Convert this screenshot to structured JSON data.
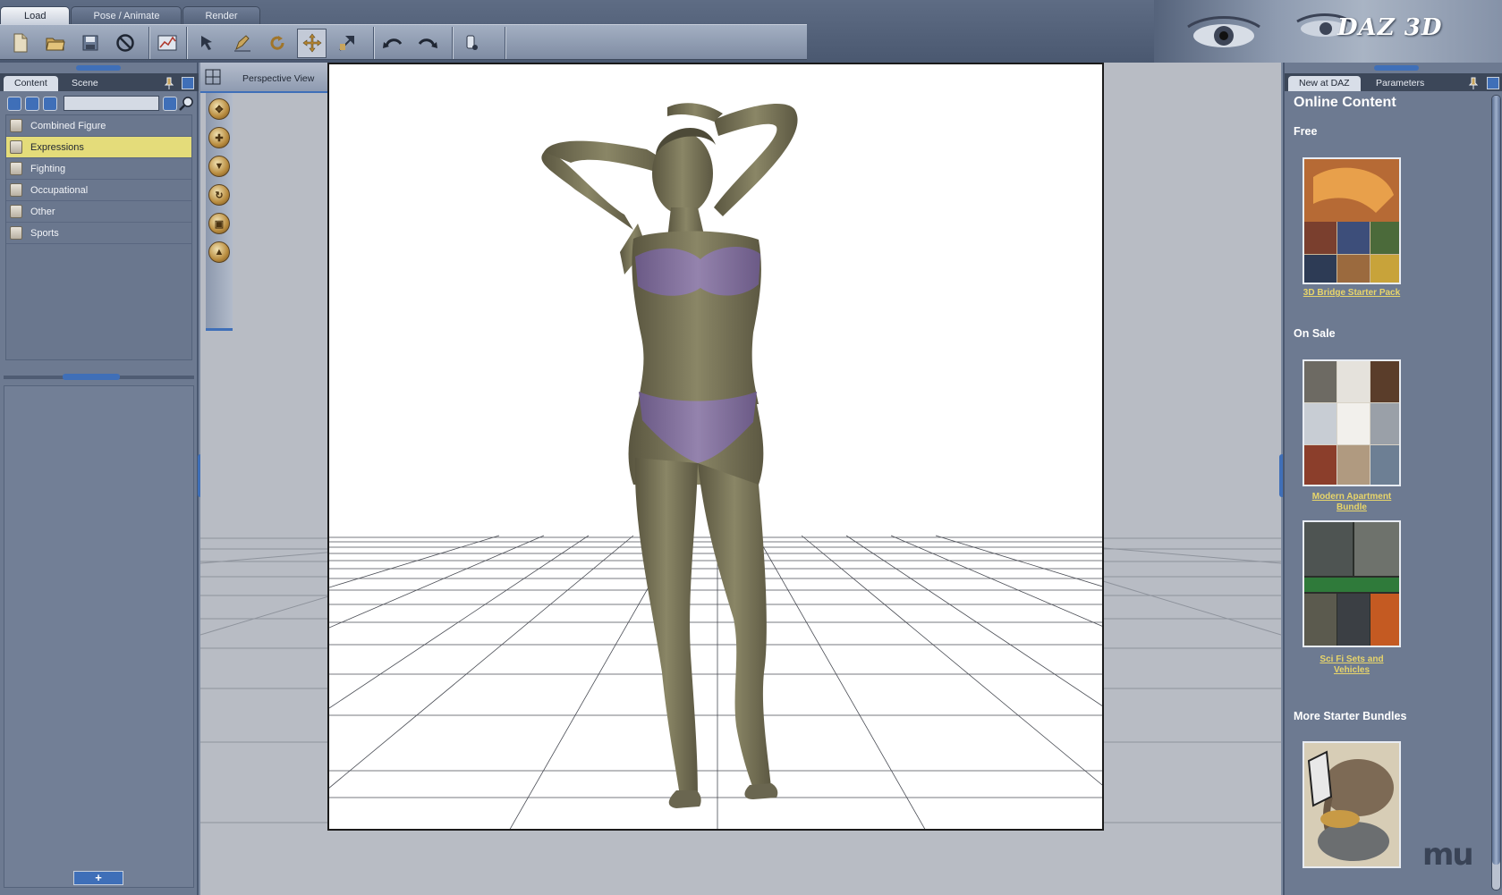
{
  "top_tabs": [
    "Load",
    "Pose / Animate",
    "Render"
  ],
  "toolbar": {
    "icons": [
      "new-file-icon",
      "open-folder-icon",
      "save-disk-icon",
      "stop-icon",
      "chart-icon",
      "select-arrow-icon",
      "pen-icon",
      "rotate-icon",
      "move-cross-icon",
      "scale-icon",
      "undo-arc-icon",
      "redo-arc-icon",
      "bone-tool-icon"
    ]
  },
  "brand": {
    "logo": "DAZ 3D"
  },
  "left_panel": {
    "tabs": [
      "Content",
      "Scene"
    ],
    "path_value": "",
    "categories": [
      "Combined Figure",
      "Expressions",
      "Fighting",
      "Occupational",
      "Other",
      "Sports"
    ],
    "selected_category": "Expressions",
    "add_label": "+"
  },
  "viewport": {
    "title": "Perspective View",
    "dropdown_arrow": "»",
    "shading_arrow": "»",
    "background_color": "#ffffff",
    "camera_tools": [
      "orbit-icon",
      "pan-icon",
      "dolly-icon",
      "rotate-camera-icon",
      "frame-icon",
      "up-icon"
    ]
  },
  "right_panel": {
    "tabs": [
      "New at DAZ",
      "Parameters"
    ],
    "heading": "Online Content",
    "sections": [
      {
        "title": "Free",
        "products": [
          {
            "name": "3D Bridge Starter Pack"
          }
        ]
      },
      {
        "title": "On Sale",
        "products": [
          {
            "name": "Modern Apartment Bundle"
          },
          {
            "name": "Sci Fi Sets and Vehicles"
          }
        ]
      },
      {
        "title": "More Starter Bundles",
        "products": [
          {
            "name": ""
          }
        ]
      }
    ]
  },
  "watermark": "mu",
  "colors": {
    "accent": "#3f6fb8",
    "selected": "#e4dc7a",
    "link": "#e8d56a"
  }
}
